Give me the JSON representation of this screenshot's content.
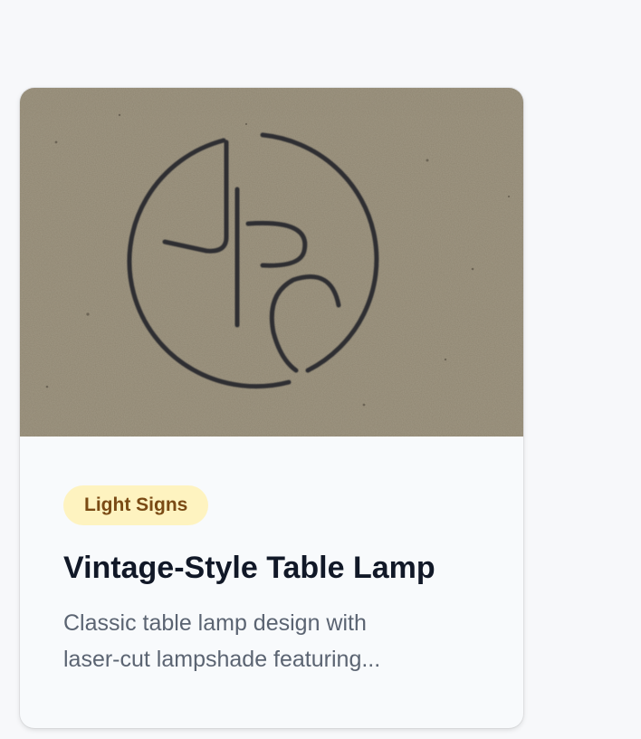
{
  "card": {
    "image_alt": "Engraved JPC monogram logo on cardboard",
    "category": "Light Signs",
    "title": "Vintage-Style Table Lamp",
    "description_line1": "Classic table lamp design with",
    "description_line2": "laser-cut lampshade featuring..."
  },
  "colors": {
    "badge_bg": "#fef3c0",
    "badge_text": "#7a4a14",
    "title": "#111827",
    "description": "#5b6472"
  }
}
